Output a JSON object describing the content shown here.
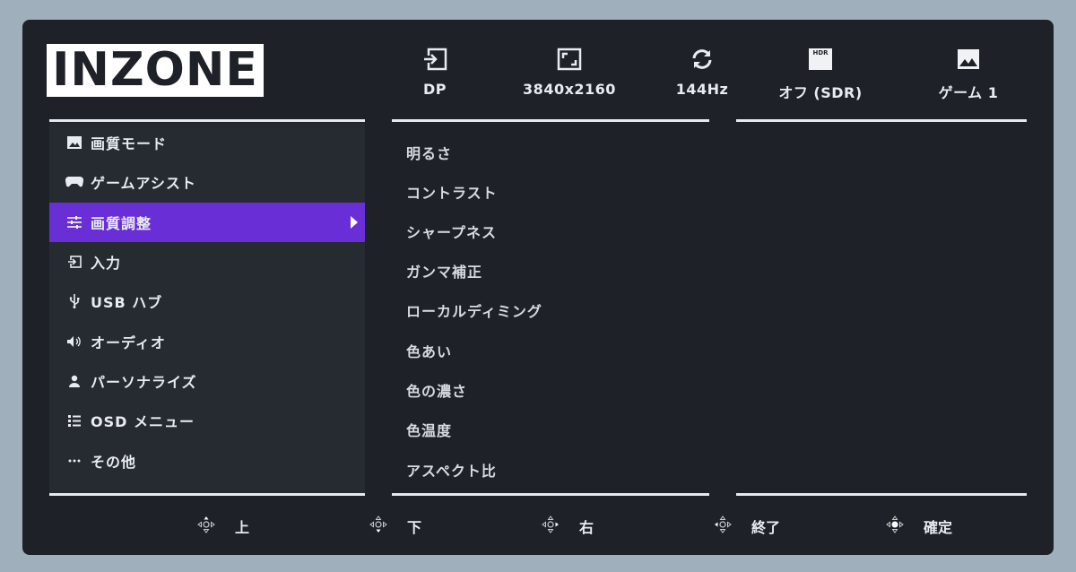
{
  "logo": "INZONE",
  "status": [
    {
      "icon": "input-icon",
      "label": "DP"
    },
    {
      "icon": "resolution-icon",
      "label": "3840x2160"
    },
    {
      "icon": "refresh-rate-icon",
      "label": "144Hz"
    },
    {
      "icon": "hdr-icon",
      "icon_text": "HDR",
      "label": "オフ (SDR)"
    },
    {
      "icon": "picture-mode-icon",
      "label": "ゲーム 1"
    }
  ],
  "menu": [
    {
      "icon": "image-icon",
      "label": "画質モード",
      "active": false
    },
    {
      "icon": "gamepad-icon",
      "label": "ゲームアシスト",
      "active": false
    },
    {
      "icon": "sliders-icon",
      "label": "画質調整",
      "active": true
    },
    {
      "icon": "input-icon",
      "label": "入力",
      "active": false
    },
    {
      "icon": "usb-icon",
      "label": "USB ハブ",
      "active": false
    },
    {
      "icon": "speaker-icon",
      "label": "オーディオ",
      "active": false
    },
    {
      "icon": "person-icon",
      "label": "パーソナライズ",
      "active": false
    },
    {
      "icon": "list-icon",
      "label": "OSD メニュー",
      "active": false
    },
    {
      "icon": "more-icon",
      "label": "その他",
      "active": false
    }
  ],
  "submenu": [
    "明るさ",
    "コントラスト",
    "シャープネス",
    "ガンマ補正",
    "ローカルディミング",
    "色あい",
    "色の濃さ",
    "色温度",
    "アスペクト比"
  ],
  "footer": [
    {
      "icon": "joystick-up-icon",
      "label": "上"
    },
    {
      "icon": "joystick-down-icon",
      "label": "下"
    },
    {
      "icon": "joystick-right-icon",
      "label": "右"
    },
    {
      "icon": "joystick-left-icon",
      "label": "終了"
    },
    {
      "icon": "joystick-press-icon",
      "label": "確定"
    }
  ],
  "colors": {
    "accent": "#6a2ed6",
    "background": "#1e2228",
    "text": "#e8ecf0"
  }
}
